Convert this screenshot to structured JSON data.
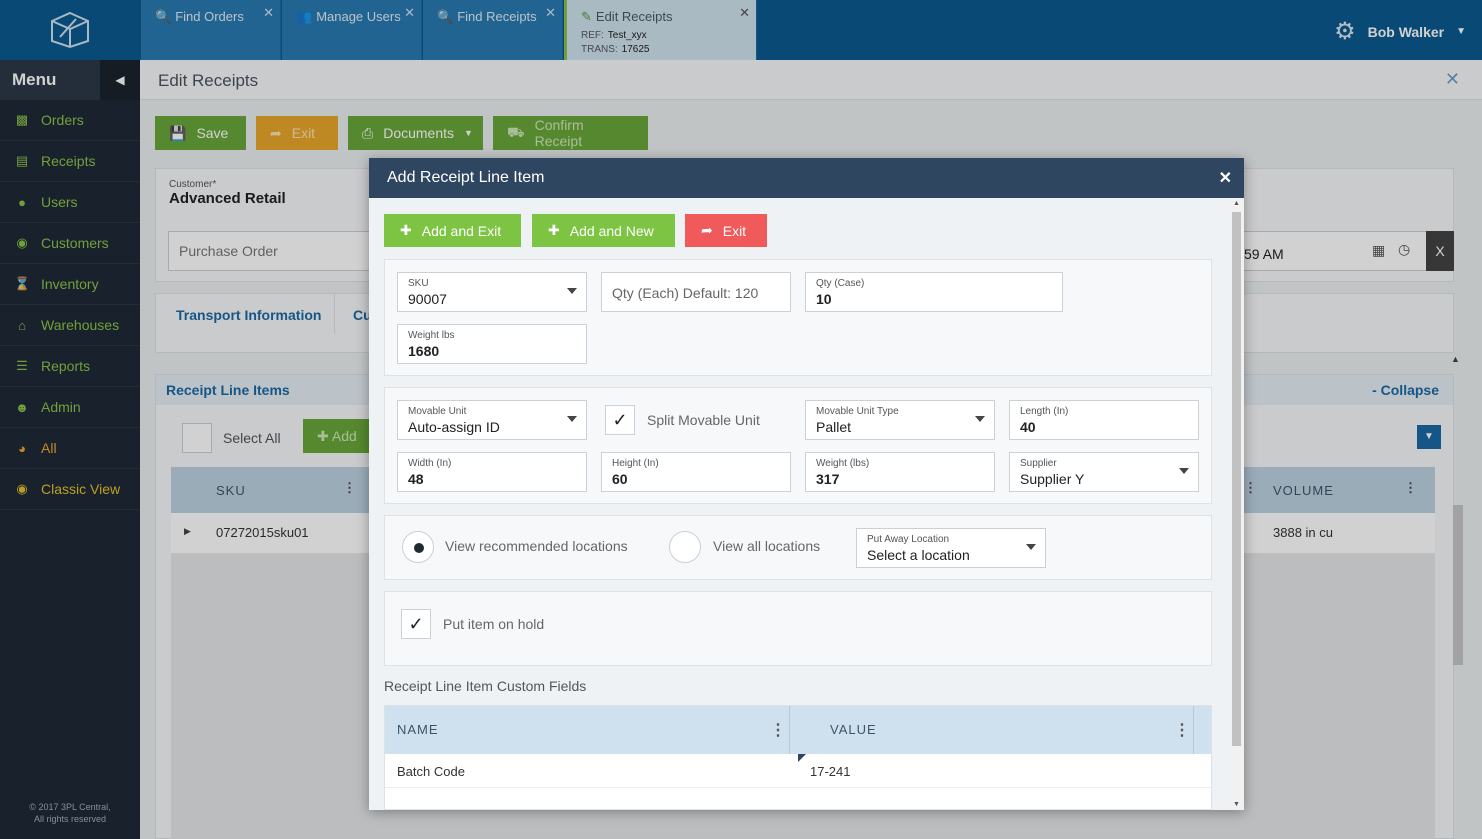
{
  "colors": {
    "topbar": "#0b5a8f",
    "sidebar": "#1f2a36",
    "accent_green": "#7dc443",
    "exit_red": "#f05a5a",
    "modal_header": "#2f4661"
  },
  "tabs": [
    {
      "label": "Find Orders",
      "icon": "search-icon"
    },
    {
      "label": "Manage Users",
      "icon": "users-icon"
    },
    {
      "label": "Find Receipts",
      "icon": "search-icon"
    },
    {
      "label": "Edit Receipts",
      "icon": "edit-icon",
      "ref_label": "REF:",
      "ref_value": "Test_xyx",
      "trans_label": "TRANS:",
      "trans_value": "17625"
    }
  ],
  "user": {
    "name": "Bob Walker"
  },
  "sidebar": {
    "title": "Menu",
    "items": [
      {
        "label": "Orders",
        "icon": "sitemap-icon"
      },
      {
        "label": "Receipts",
        "icon": "document-icon"
      },
      {
        "label": "Users",
        "icon": "users-icon"
      },
      {
        "label": "Customers",
        "icon": "eye-icon"
      },
      {
        "label": "Inventory",
        "icon": "hourglass-icon"
      },
      {
        "label": "Warehouses",
        "icon": "home-icon"
      },
      {
        "label": "Reports",
        "icon": "list-icon"
      },
      {
        "label": "Admin",
        "icon": "person-icon"
      },
      {
        "label": "All",
        "icon": "globe-icon"
      },
      {
        "label": "Classic View",
        "icon": "eye-icon"
      }
    ],
    "copyright_line1": "© 2017 3PL Central,",
    "copyright_line2": "All rights reserved"
  },
  "page": {
    "title": "Edit Receipts",
    "buttons": {
      "save": "Save",
      "exit": "Exit",
      "documents": "Documents",
      "confirm": "Confirm Receipt"
    },
    "customer_label": "Customer*",
    "customer_value": "Advanced Retail",
    "purchase_order_placeholder": "Purchase Order",
    "time_value": "59 AM",
    "clear_label": "X",
    "tab_transport": "Transport Information",
    "tab_cu": "Cu",
    "line_items_title": "Receipt Line Items",
    "collapse_label": "- Collapse",
    "select_all": "Select All",
    "add_label": "Add",
    "grid": {
      "col_sku": "SKU",
      "col_volume": "VOLUME",
      "row_sku": "07272015sku01",
      "row_volume": "3888 in cu"
    }
  },
  "modal": {
    "title": "Add Receipt Line Item",
    "buttons": {
      "add_exit": "Add and Exit",
      "add_new": "Add and New",
      "exit": "Exit"
    },
    "sku": {
      "label": "SKU",
      "value": "90007"
    },
    "qty_each": {
      "placeholder": "Qty (Each) Default: 120"
    },
    "qty_case": {
      "label": "Qty (Case)",
      "value": "10"
    },
    "weight_lbs": {
      "label": "Weight lbs",
      "value": "1680"
    },
    "movable_unit": {
      "label": "Movable Unit",
      "value": "Auto-assign ID"
    },
    "split_movable": {
      "label": "Split Movable Unit",
      "checked": true
    },
    "movable_unit_type": {
      "label": "Movable Unit Type",
      "value": "Pallet"
    },
    "length": {
      "label": "Length (In)",
      "value": "40"
    },
    "width": {
      "label": "Width (In)",
      "value": "48"
    },
    "height": {
      "label": "Height (In)",
      "value": "60"
    },
    "weight": {
      "label": "Weight (lbs)",
      "value": "317"
    },
    "supplier": {
      "label": "Supplier",
      "value": "Supplier Y"
    },
    "view_recommended": "View recommended locations",
    "view_all": "View all locations",
    "put_away": {
      "label": "Put Away Location",
      "value": "Select a location"
    },
    "put_on_hold": {
      "label": "Put item on hold",
      "checked": true
    },
    "custom_fields_title": "Receipt Line Item Custom Fields",
    "custom_fields": {
      "col_name": "NAME",
      "col_value": "VALUE",
      "rows": [
        {
          "name": "Batch Code",
          "value": "17-241"
        }
      ]
    }
  }
}
